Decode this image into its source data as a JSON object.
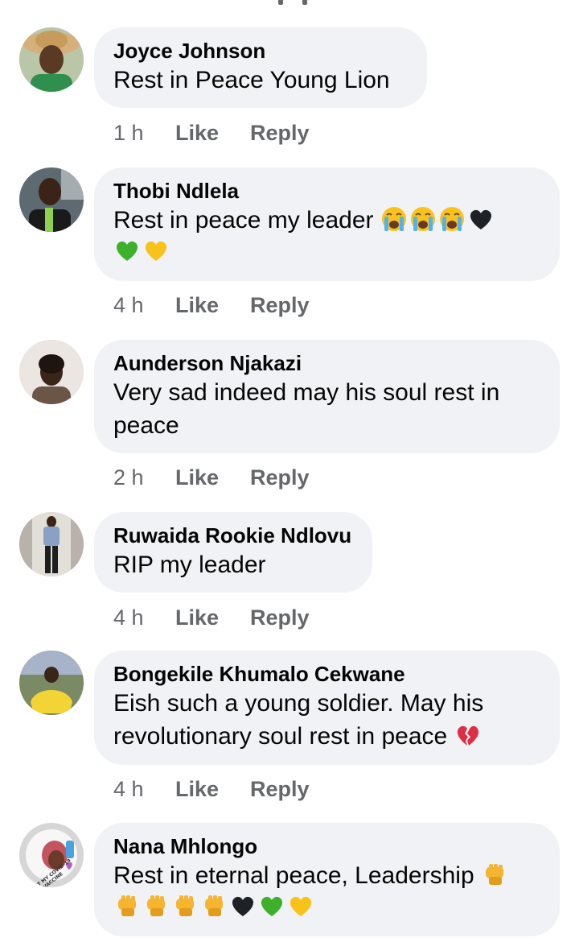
{
  "comments": [
    {
      "name": "Joyce Johnson",
      "text_lines": [
        "Rest in Peace Young Lion"
      ],
      "time": "1 h",
      "like": "Like",
      "reply": "Reply",
      "avatar": "woman-in-hat-avatar"
    },
    {
      "name": "Thobi Ndlela",
      "text_lines": [
        "Rest in peace my leader"
      ],
      "emoji_line1": [
        "loudly-crying-face",
        "loudly-crying-face",
        "loudly-crying-face",
        "black-heart"
      ],
      "emoji_line2": [
        "green-heart",
        "yellow-heart"
      ],
      "time": "4 h",
      "like": "Like",
      "reply": "Reply",
      "avatar": "woman-portrait-avatar"
    },
    {
      "name": "Aunderson Njakazi",
      "text_lines": [
        "Very sad indeed may his soul rest in",
        "peace"
      ],
      "time": "2 h",
      "like": "Like",
      "reply": "Reply",
      "avatar": "woman-selfie-avatar"
    },
    {
      "name": "Ruwaida Rookie Ndlovu",
      "text_lines": [
        "RIP my leader"
      ],
      "time": "4 h",
      "like": "Like",
      "reply": "Reply",
      "avatar": "man-standing-avatar"
    },
    {
      "name": "Bongekile Khumalo Cekwane",
      "text_lines": [
        "Eish such a young soldier. May his",
        "revolutionary soul rest in peace"
      ],
      "emoji_end": [
        "broken-heart"
      ],
      "time": "4 h",
      "like": "Like",
      "reply": "Reply",
      "avatar": "woman-yellow-dress-avatar"
    },
    {
      "name": "Nana Mhlongo",
      "text_lines": [
        "Rest in eternal peace, Leadership"
      ],
      "emoji_end": [
        "raised-fist"
      ],
      "emoji_line2": [
        "raised-fist",
        "raised-fist",
        "raised-fist",
        "raised-fist",
        "black-heart",
        "green-heart",
        "yellow-heart"
      ],
      "avatar_frame_text": "I GOT MY COVID-19 VACCINE",
      "avatar": "vaccine-frame-avatar"
    }
  ],
  "colors": {
    "bubble": "#f0f2f5",
    "meta": "#65676b",
    "text": "#050505"
  }
}
